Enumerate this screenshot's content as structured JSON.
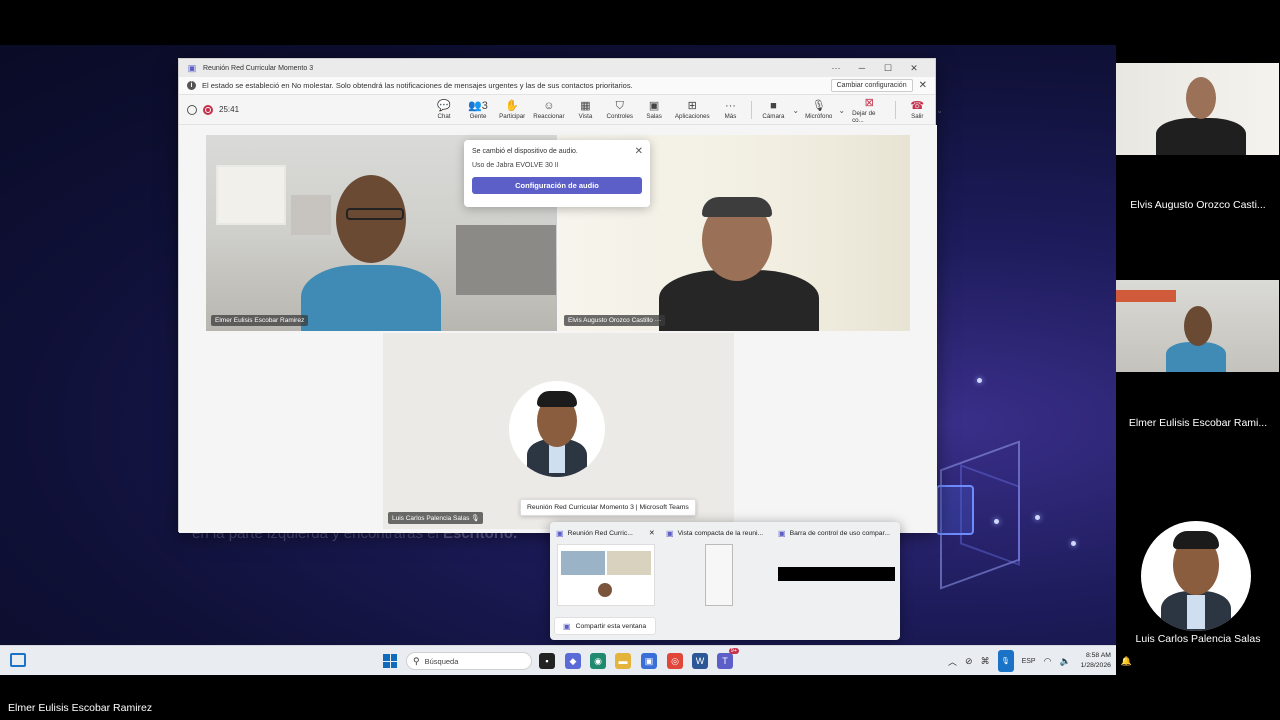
{
  "window": {
    "title": "Reunión Red Curricular Momento 3"
  },
  "notice": {
    "text": "El estado se estableció en No molestar. Solo obtendrá las notificaciones de mensajes urgentes y las de sus contactos prioritarios.",
    "button": "Cambiar configuración"
  },
  "toolbar": {
    "timer": "25:41",
    "items": [
      {
        "label": "Chat",
        "icon": "chat-icon",
        "glyph": "💬"
      },
      {
        "label": "Gente",
        "icon": "people-icon",
        "glyph": "👥3"
      },
      {
        "label": "Participar",
        "icon": "raise-hand-icon",
        "glyph": "✋"
      },
      {
        "label": "Reaccionar",
        "icon": "smile-icon",
        "glyph": "☺"
      },
      {
        "label": "Vista",
        "icon": "grid-icon",
        "glyph": "▦"
      },
      {
        "label": "Controles",
        "icon": "shield-icon",
        "glyph": "⛉"
      },
      {
        "label": "Salas",
        "icon": "rooms-icon",
        "glyph": "▣"
      },
      {
        "label": "Aplicaciones",
        "icon": "add-apps-icon",
        "glyph": "⊞"
      },
      {
        "label": "Más",
        "icon": "more-icon",
        "glyph": "···"
      }
    ],
    "camera": "Cámara",
    "mic": "Micrófono",
    "stop_share": "Dejar de co...",
    "leave": "Salir"
  },
  "participants": {
    "tile1": "Elmer Eulisis Escobar Ramirez",
    "tile2": "Elvis Augusto Orozco Castillo",
    "tile3": "Luis Carlos Palencia Salas"
  },
  "popup": {
    "title": "Se cambió el dispositivo de audio.",
    "sub": "Uso de Jabra EVOLVE 30 II",
    "button": "Configuración de audio"
  },
  "tooltip": "Reunión Red Curricular Momento 3 | Microsoft Teams",
  "preview": {
    "col1": "Reunión Red Curric...",
    "col2": "Vista compacta de la reuni...",
    "col3": "Barra de control de uso compar...",
    "share": "Compartir esta ventana"
  },
  "background_text": {
    "plain": "en la parte izquierda y encontrarás el ",
    "bold": "Escritorio."
  },
  "taskbar": {
    "search": "Búsqueda",
    "lang": "ESP",
    "time": "8:58 AM",
    "date": "1/28/2026",
    "badge": "9+"
  },
  "right_panel": {
    "name1": "Elvis Augusto Orozco Casti...",
    "name2": "Elmer Eulisis Escobar Rami...",
    "name3": "Luis Carlos Palencia Salas"
  },
  "bottom_name": "Elmer Eulisis Escobar Ramirez",
  "colors": {
    "teams_purple": "#5b5fc7",
    "record_red": "#c4314b",
    "taskbar": "#e9edf2"
  }
}
